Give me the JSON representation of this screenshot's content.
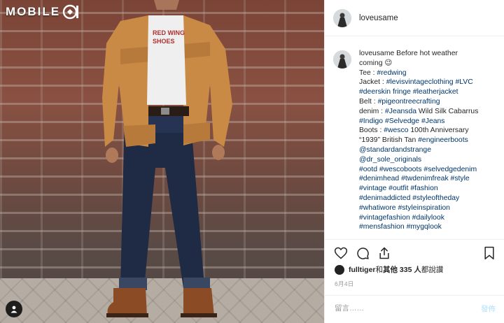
{
  "watermark": {
    "text": "MOBILE"
  },
  "header": {
    "username": "loveusame"
  },
  "caption": {
    "username": "loveusame",
    "first_line": "Before hot weather",
    "lines": [
      [
        {
          "t": "coming 😉",
          "tag": false
        }
      ],
      [
        {
          "t": "Tee : ",
          "tag": false
        },
        {
          "t": "#redwing",
          "tag": true
        }
      ],
      [
        {
          "t": "Jacket : ",
          "tag": false
        },
        {
          "t": "#levisvintageclothing #LVC",
          "tag": true
        }
      ],
      [
        {
          "t": "#deerskin fringe #leatherjacket",
          "tag": true
        }
      ],
      [
        {
          "t": "Belt : ",
          "tag": false
        },
        {
          "t": "#pigeontreecrafting",
          "tag": true
        }
      ],
      [
        {
          "t": "denim : ",
          "tag": false
        },
        {
          "t": "#Jeansda",
          "tag": true
        },
        {
          "t": " Wild Silk Cabarrus",
          "tag": false
        }
      ],
      [
        {
          "t": "#Indigo #Selvedge #Jeans",
          "tag": true
        }
      ],
      [
        {
          "t": "Boots : ",
          "tag": false
        },
        {
          "t": "#wesco",
          "tag": true
        },
        {
          "t": " 100th Anniversary",
          "tag": false
        }
      ],
      [
        {
          "t": "“1939” British Tan ",
          "tag": false
        },
        {
          "t": "#engineerboots",
          "tag": true
        }
      ],
      [
        {
          "t": "@standardandstrange",
          "tag": true
        }
      ],
      [
        {
          "t": "@dr_sole_originals",
          "tag": true
        }
      ],
      [
        {
          "t": "#ootd #wescoboots #selvedgedenim",
          "tag": true
        }
      ],
      [
        {
          "t": "#denimhead #twdenimfreak #style",
          "tag": true
        }
      ],
      [
        {
          "t": "#vintage #outfit #fashion",
          "tag": true
        }
      ],
      [
        {
          "t": "#denimaddicted #styleoftheday",
          "tag": true
        }
      ],
      [
        {
          "t": "#whatiwore #styleinspiration",
          "tag": true
        }
      ],
      [
        {
          "t": "#vintagefashion #dailylook",
          "tag": true
        }
      ],
      [
        {
          "t": "#mensfashion #mygqlook",
          "tag": true
        }
      ]
    ]
  },
  "actions": {
    "like_icon": "heart-icon",
    "comment_icon": "comment-icon",
    "share_icon": "share-icon",
    "save_icon": "bookmark-icon"
  },
  "likes": {
    "user": "fulltiger",
    "middle": " 和 ",
    "others": "其他 335 人",
    "suffix": " 都說讚"
  },
  "date": "6月4日",
  "comment": {
    "placeholder": "留言……",
    "post_label": "發佈"
  },
  "colors": {
    "hashtag": "#003569",
    "post_disabled": "#b2dffc",
    "meta": "#999999"
  }
}
